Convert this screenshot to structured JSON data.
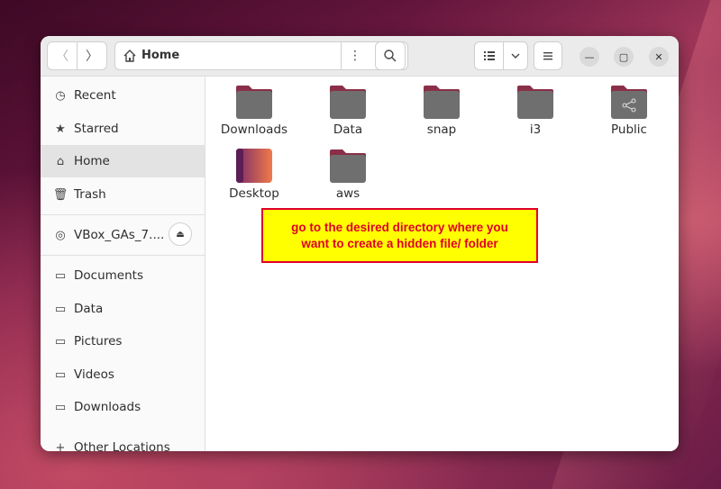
{
  "path_bar": {
    "location": "Home",
    "menu_glyph": "⋮"
  },
  "toolbar": {
    "back_glyph": "〈",
    "forward_glyph": "〉",
    "search_glyph": "⌕",
    "list_view_glyph": "☰",
    "dropdown_glyph": "⌄",
    "menu_glyph": "≡"
  },
  "window_controls": {
    "minimize": "—",
    "maximize": "▢",
    "close": "✕"
  },
  "sidebar": {
    "items": [
      {
        "label": "Recent",
        "icon": "clock-icon",
        "glyph": "◷"
      },
      {
        "label": "Starred",
        "icon": "star-icon",
        "glyph": "★"
      },
      {
        "label": "Home",
        "icon": "home-icon",
        "glyph": "⌂"
      },
      {
        "label": "Trash",
        "icon": "trash-icon",
        "glyph": "🗑"
      },
      {
        "label": "VBox_GAs_7....",
        "icon": "disc-icon",
        "glyph": "◎",
        "eject_glyph": "⏏"
      },
      {
        "label": "Documents",
        "icon": "folder-icon",
        "glyph": "▭"
      },
      {
        "label": "Data",
        "icon": "folder-icon",
        "glyph": "▭"
      },
      {
        "label": "Pictures",
        "icon": "folder-icon",
        "glyph": "▭"
      },
      {
        "label": "Videos",
        "icon": "folder-icon",
        "glyph": "▭"
      },
      {
        "label": "Downloads",
        "icon": "folder-icon",
        "glyph": "▭"
      },
      {
        "label": "Other Locations",
        "icon": "plus-icon",
        "glyph": "+"
      }
    ],
    "active": "Home"
  },
  "files": [
    {
      "name": "Downloads",
      "kind": "folder"
    },
    {
      "name": "Data",
      "kind": "folder"
    },
    {
      "name": "snap",
      "kind": "folder"
    },
    {
      "name": "i3",
      "kind": "folder"
    },
    {
      "name": "Public",
      "kind": "shared-folder"
    },
    {
      "name": "Desktop",
      "kind": "desktop-folder"
    },
    {
      "name": "aws",
      "kind": "folder"
    }
  ],
  "annotation": {
    "line1": "go to the desired directory where you",
    "line2": "want to create a hidden file/ folder"
  },
  "colors": {
    "folder_body": "#6f6f6f",
    "folder_tab": "#8a2f48",
    "desktop_start": "#7a2a6a",
    "desktop_end": "#f07a4a",
    "annotation_bg": "#ffff00",
    "annotation_text": "#e0002a"
  }
}
